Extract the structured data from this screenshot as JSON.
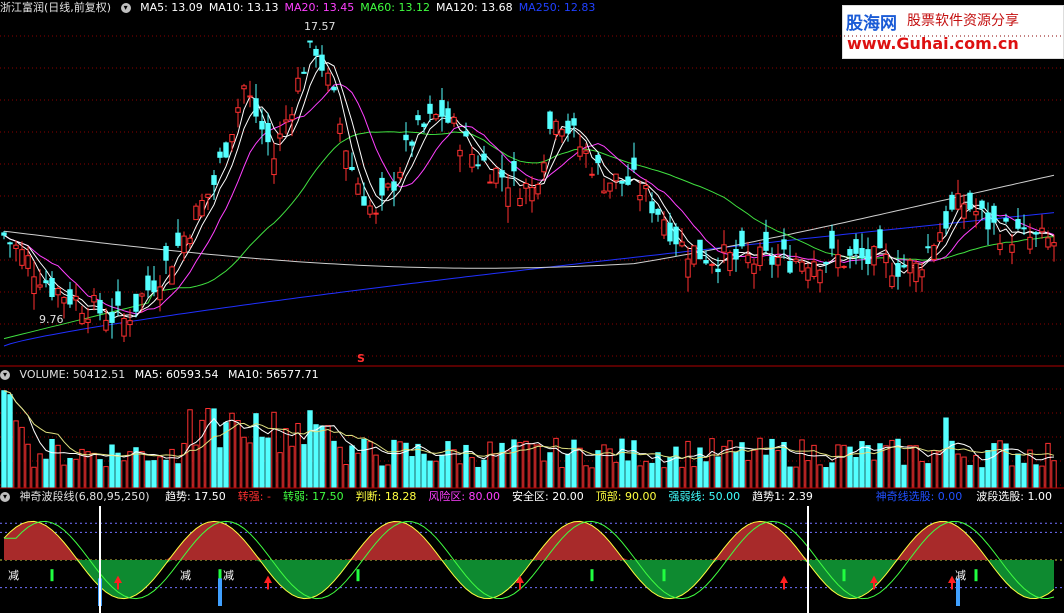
{
  "price_header": {
    "stock": "浙江富润(日线,前复权)",
    "ma": [
      {
        "label": "MA5: 13.09",
        "color": "#ffffff"
      },
      {
        "label": "MA10: 13.13",
        "color": "#ffffff"
      },
      {
        "label": "MA20: 13.45",
        "color": "#ff40ff"
      },
      {
        "label": "MA60: 13.12",
        "color": "#40ff40"
      },
      {
        "label": "MA120: 13.68",
        "color": "#ffffff"
      },
      {
        "label": "MA250: 12.83",
        "color": "#2040ff"
      }
    ]
  },
  "price_labels": {
    "high": "17.57",
    "low": "9.76",
    "marker": "S"
  },
  "volume_header": {
    "title": "VOLUME: 50412.51",
    "ma5": "MA5: 60593.54",
    "ma10": "MA10: 56577.71"
  },
  "indicator_header": {
    "name": "神奇波段线(6,80,95,250)",
    "items": [
      {
        "label": "趋势: 17.50",
        "color": "#ffffff"
      },
      {
        "label": "转强: -",
        "color": "#ff3030"
      },
      {
        "label": "转弱: 17.50",
        "color": "#40ff40"
      },
      {
        "label": "判断: 18.28",
        "color": "#ffff40"
      },
      {
        "label": "风险区: 80.00",
        "color": "#ff40ff"
      },
      {
        "label": "安全区: 20.00",
        "color": "#ffffff"
      },
      {
        "label": "顶部: 90.00",
        "color": "#ffff40"
      },
      {
        "label": "强弱线: 50.00",
        "color": "#40ffff"
      },
      {
        "label": "趋势1: 2.39",
        "color": "#ffffff"
      }
    ],
    "right_items": [
      {
        "label": "神奇线选股: 0.00",
        "color": "#2050ff"
      },
      {
        "label": "波段选股: 1.00",
        "color": "#ffffff"
      }
    ]
  },
  "indicator_labels": {
    "reduce": "减"
  },
  "watermark": {
    "logo": "股海网",
    "subtitle": "股票软件资源分享",
    "url": "www.Guhai.com.cn"
  },
  "chart_data": {
    "type": "candlestick",
    "price_high": 17.57,
    "price_low": 9.76,
    "ma_current": {
      "MA5": 13.09,
      "MA10": 13.13,
      "MA20": 13.45,
      "MA60": 13.12,
      "MA120": 13.68,
      "MA250": 12.83
    },
    "volume_current": 50412.51,
    "volume_ma": {
      "MA5": 60593.54,
      "MA10": 56577.71
    }
  }
}
